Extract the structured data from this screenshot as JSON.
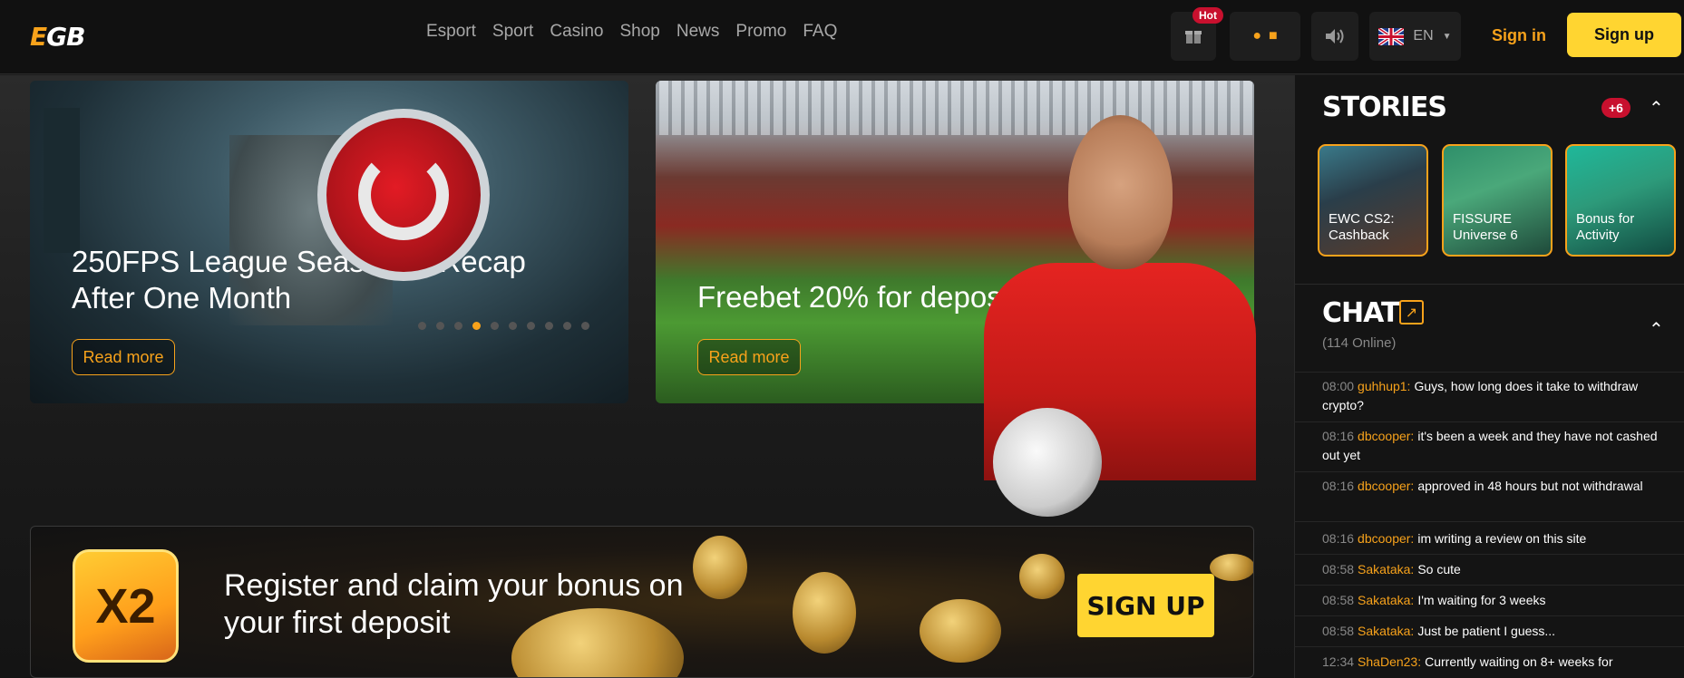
{
  "header": {
    "logo": "EGB",
    "nav": [
      "Esport",
      "Sport",
      "Casino",
      "Shop",
      "News",
      "Promo",
      "FAQ"
    ],
    "hot_badge": "Hot",
    "language": "EN",
    "sign_in": "Sign in",
    "sign_up": "Sign up"
  },
  "banners": [
    {
      "title": "250FPS League Season 3: Recap After One Month",
      "cta": "Read more",
      "dots": 10,
      "active_dot": 3
    },
    {
      "title": "Freebet 20% for deposit",
      "cta": "Read more",
      "dots": 6,
      "active_dot": 3
    }
  ],
  "promo": {
    "badge": "X2",
    "text": "Register and claim your bonus on your first deposit",
    "cta": "SIGN UP"
  },
  "stories": {
    "title": "STORIES",
    "extra_count": "+6",
    "items": [
      {
        "label": "EWC CS2: Cashback"
      },
      {
        "label": "FISSURE Universe 6"
      },
      {
        "label": "Bonus for Activity"
      }
    ]
  },
  "chat": {
    "title": "CHAT",
    "online": "(114 Online)",
    "messages": [
      {
        "time": "08:00",
        "user": "guhhup1:",
        "text": "Guys, how long does it take to withdraw crypto?"
      },
      {
        "time": "08:16",
        "user": "dbcooper:",
        "text": "it's been a week and they have not cashed out yet"
      },
      {
        "time": "08:16",
        "user": "dbcooper:",
        "text": "approved in 48 hours but not withdrawal"
      },
      {
        "time": "08:16",
        "user": "dbcooper:",
        "text": "im writing a review on this site"
      },
      {
        "time": "08:58",
        "user": "Sakataka:",
        "text": "So cute"
      },
      {
        "time": "08:58",
        "user": "Sakataka:",
        "text": "I'm waiting for 3 weeks"
      },
      {
        "time": "08:58",
        "user": "Sakataka:",
        "text": "Just be patient I guess..."
      },
      {
        "time": "12:34",
        "user": "ShaDen23:",
        "text": "Currently waiting on 8+ weeks for"
      }
    ]
  },
  "colors": {
    "accent": "#f7a21b",
    "brand_yellow": "#ffd531",
    "badge_red": "#c8102e"
  }
}
